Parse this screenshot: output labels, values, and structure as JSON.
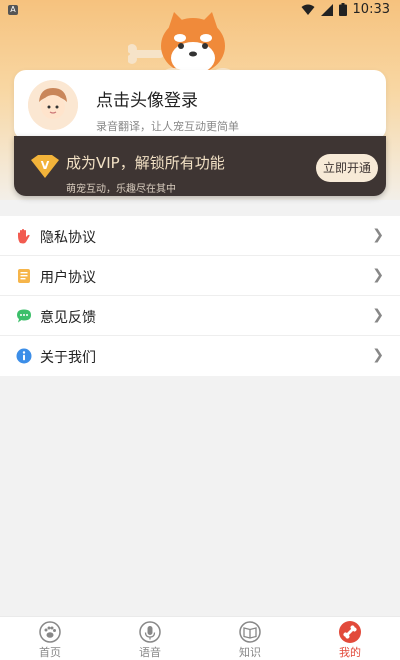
{
  "statusbar": {
    "time": "10:33",
    "app_icon": "A"
  },
  "login": {
    "title": "点击头像登录",
    "subtitle": "录音翻译，让人宠互动更简单"
  },
  "vip": {
    "title": "成为VIP，解锁所有功能",
    "subtitle": "萌宠互动，乐趣尽在其中",
    "button": "立即开通"
  },
  "menu": [
    {
      "label": "隐私协议",
      "icon": "hand-icon",
      "color": "#f25b50"
    },
    {
      "label": "用户协议",
      "icon": "document-icon",
      "color": "#f6b54a"
    },
    {
      "label": "意见反馈",
      "icon": "chat-icon",
      "color": "#3cbf6a"
    },
    {
      "label": "关于我们",
      "icon": "info-icon",
      "color": "#3c8ee8"
    }
  ],
  "tabs": [
    {
      "label": "首页",
      "icon": "paw-icon"
    },
    {
      "label": "语音",
      "icon": "mic-icon"
    },
    {
      "label": "知识",
      "icon": "book-icon"
    },
    {
      "label": "我的",
      "icon": "bone-icon",
      "active": true
    }
  ],
  "colors": {
    "accent": "#e24a3b",
    "vip_bg": "#3e3533",
    "vip_text": "#f2e1c5"
  }
}
